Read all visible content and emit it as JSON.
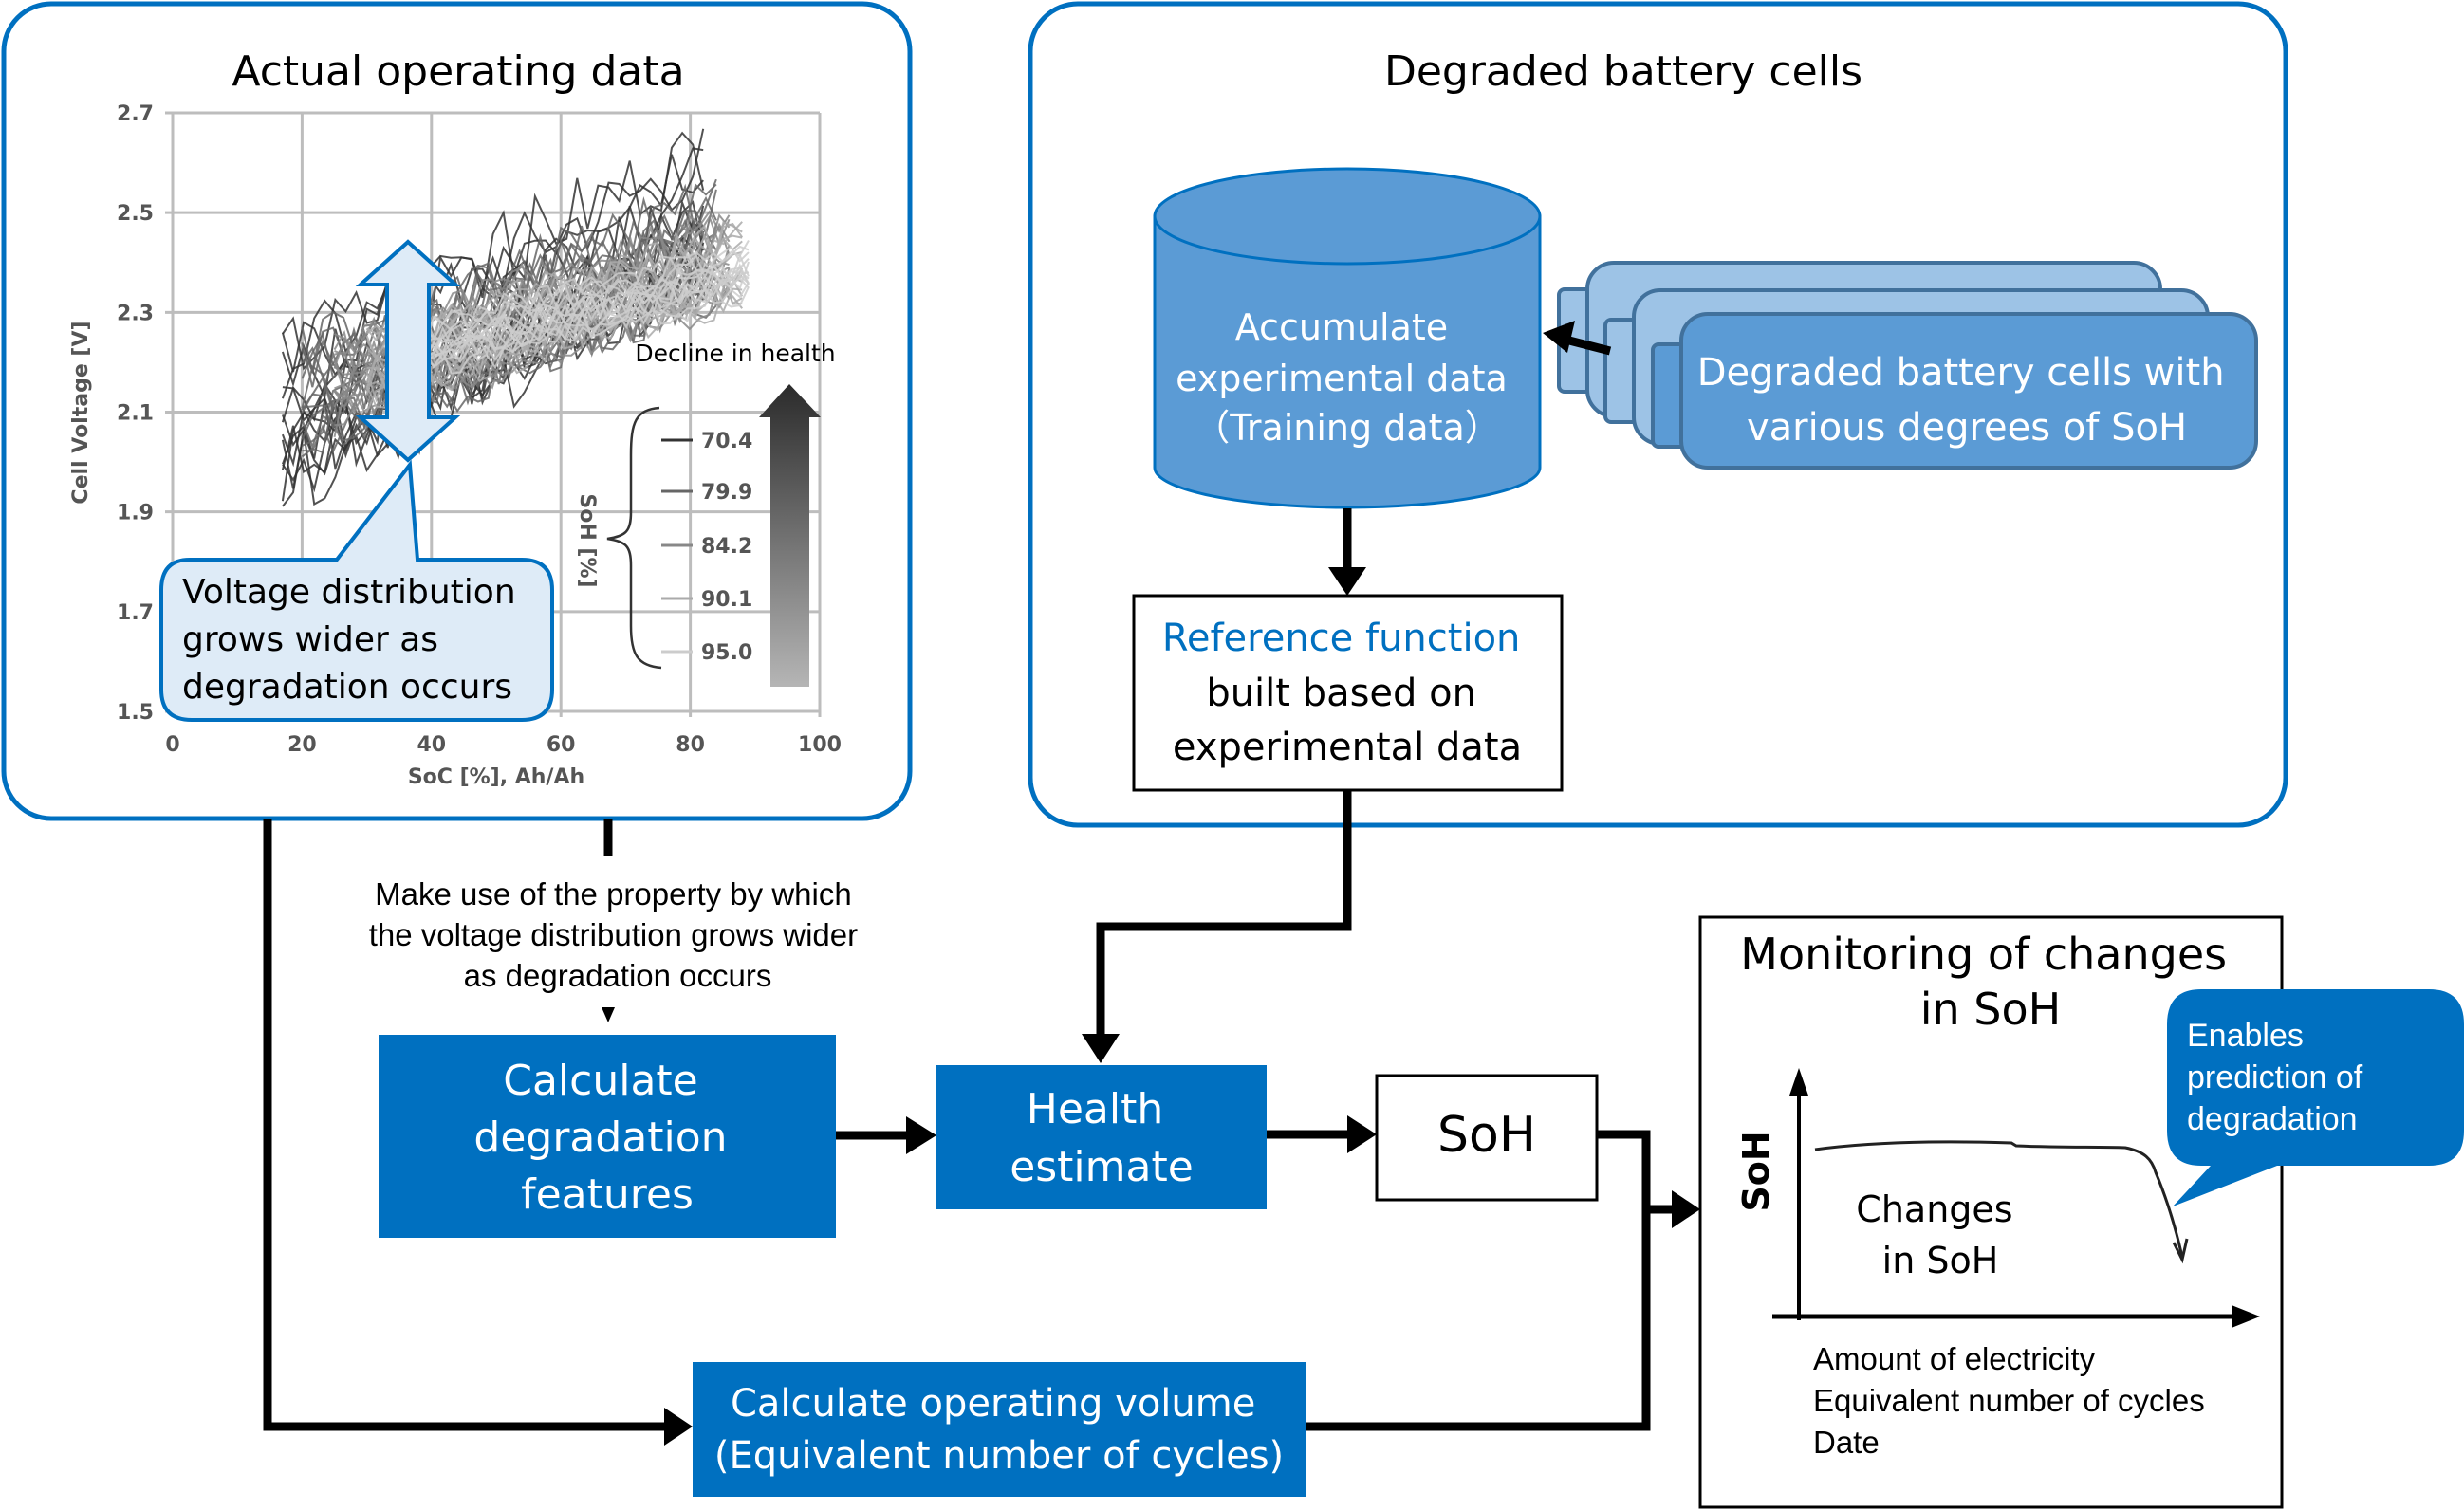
{
  "left_panel": {
    "title": "Actual operating data",
    "callout": [
      "Voltage distribution",
      "grows wider as",
      "degradation occurs"
    ],
    "legend_annotation": "Decline in health"
  },
  "chart_data": {
    "type": "line",
    "title": "Actual operating data",
    "xlabel": "SoC [%], Ah/Ah",
    "ylabel": "Cell Voltage [V]",
    "xlim": [
      0,
      100
    ],
    "ylim": [
      1.5,
      2.7
    ],
    "x_ticks": [
      "0",
      "20",
      "40",
      "60",
      "80",
      "100"
    ],
    "y_ticks": [
      "2.7",
      "2.5",
      "2.3",
      "2.1",
      "1.9",
      "1.7",
      "1.5"
    ],
    "grid": true,
    "legend_title": "SoH [%]",
    "legend_placement": "bottom-right",
    "series": [
      {
        "name": "70.4",
        "color": "#333333",
        "voltage_band": [
          1.9,
          2.65
        ],
        "soc_range": [
          17,
          82
        ]
      },
      {
        "name": "79.9",
        "color": "#666666",
        "voltage_band": [
          2.0,
          2.55
        ],
        "soc_range": [
          20,
          84
        ]
      },
      {
        "name": "84.2",
        "color": "#888888",
        "voltage_band": [
          2.05,
          2.5
        ],
        "soc_range": [
          25,
          86
        ]
      },
      {
        "name": "90.1",
        "color": "#aaaaaa",
        "voltage_band": [
          2.1,
          2.48
        ],
        "soc_range": [
          30,
          88
        ]
      },
      {
        "name": "95.0",
        "color": "#cccccc",
        "voltage_band": [
          2.15,
          2.45
        ],
        "soc_range": [
          35,
          89
        ]
      }
    ]
  },
  "right_panel": {
    "title": "Degraded battery cells",
    "database": [
      "Accumulate",
      "experimental data",
      "（Training data）"
    ],
    "cells_label": [
      "Degraded battery cells with",
      "various degrees of SoH"
    ],
    "reference": {
      "highlight": "Reference function",
      "lines": [
        "built based on",
        "experimental data"
      ]
    }
  },
  "flow": {
    "property_note": [
      "Make use of the property by which",
      "the voltage distribution grows wider",
      "as degradation occurs"
    ],
    "calc_features": [
      "Calculate",
      "degradation",
      "features"
    ],
    "health_estimate": [
      "Health",
      "estimate"
    ],
    "soh": "SoH",
    "calc_volume": [
      "Calculate operating volume",
      "(Equivalent number of cycles)"
    ]
  },
  "monitoring": {
    "title": [
      "Monitoring of changes",
      "in SoH"
    ],
    "y_axis_label": "SoH",
    "curve_label": [
      "Changes",
      "in SoH"
    ],
    "x_axis_labels": [
      "Amount of electricity",
      "Equivalent number of cycles",
      "Date"
    ],
    "callout": [
      "Enables",
      "prediction of",
      "degradation"
    ]
  },
  "colors": {
    "brand_blue": "#0070C0",
    "light_blue": "#5B9BD5",
    "pale_blue": "#9DC3E6",
    "callout_fill": "#DEEBF7",
    "cell_border": "#41719C"
  }
}
